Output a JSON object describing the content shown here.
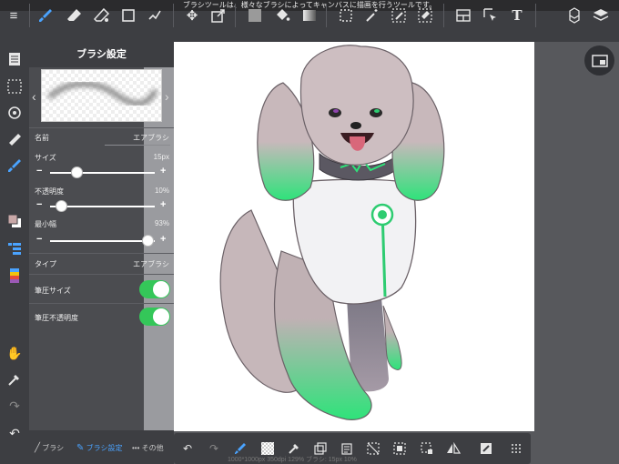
{
  "status": {
    "text": "ブラシツールは、様々なブラシによってキャンバスに描画を行うツールです。"
  },
  "panel": {
    "title": "ブラシ設定",
    "name_label": "名前",
    "name_value": "エアブラシ",
    "size_label": "サイズ",
    "size_value": "15px",
    "opacity_label": "不透明度",
    "opacity_value": "10%",
    "min_width_label": "最小幅",
    "min_width_value": "93%",
    "type_label": "タイプ",
    "type_value": "エアブラシ",
    "pressure_size_label": "筆圧サイズ",
    "pressure_opacity_label": "筆圧不透明度",
    "pressure_size_on": true,
    "pressure_opacity_on": true,
    "size_level": 0.25,
    "opacity_level": 0.1,
    "min_width_level": 0.93
  },
  "panel_tabs": {
    "brush": "ブラシ",
    "brush_settings": "ブラシ設定",
    "other": "その他"
  },
  "canvas_info": "1000*1000px 350dpi 129% ブラシ: 15px 10%",
  "colors": {
    "accent": "#4aa3ff",
    "toggle_on": "#34c759",
    "bar": "#3d3e42",
    "panel": "#4b4c50"
  }
}
